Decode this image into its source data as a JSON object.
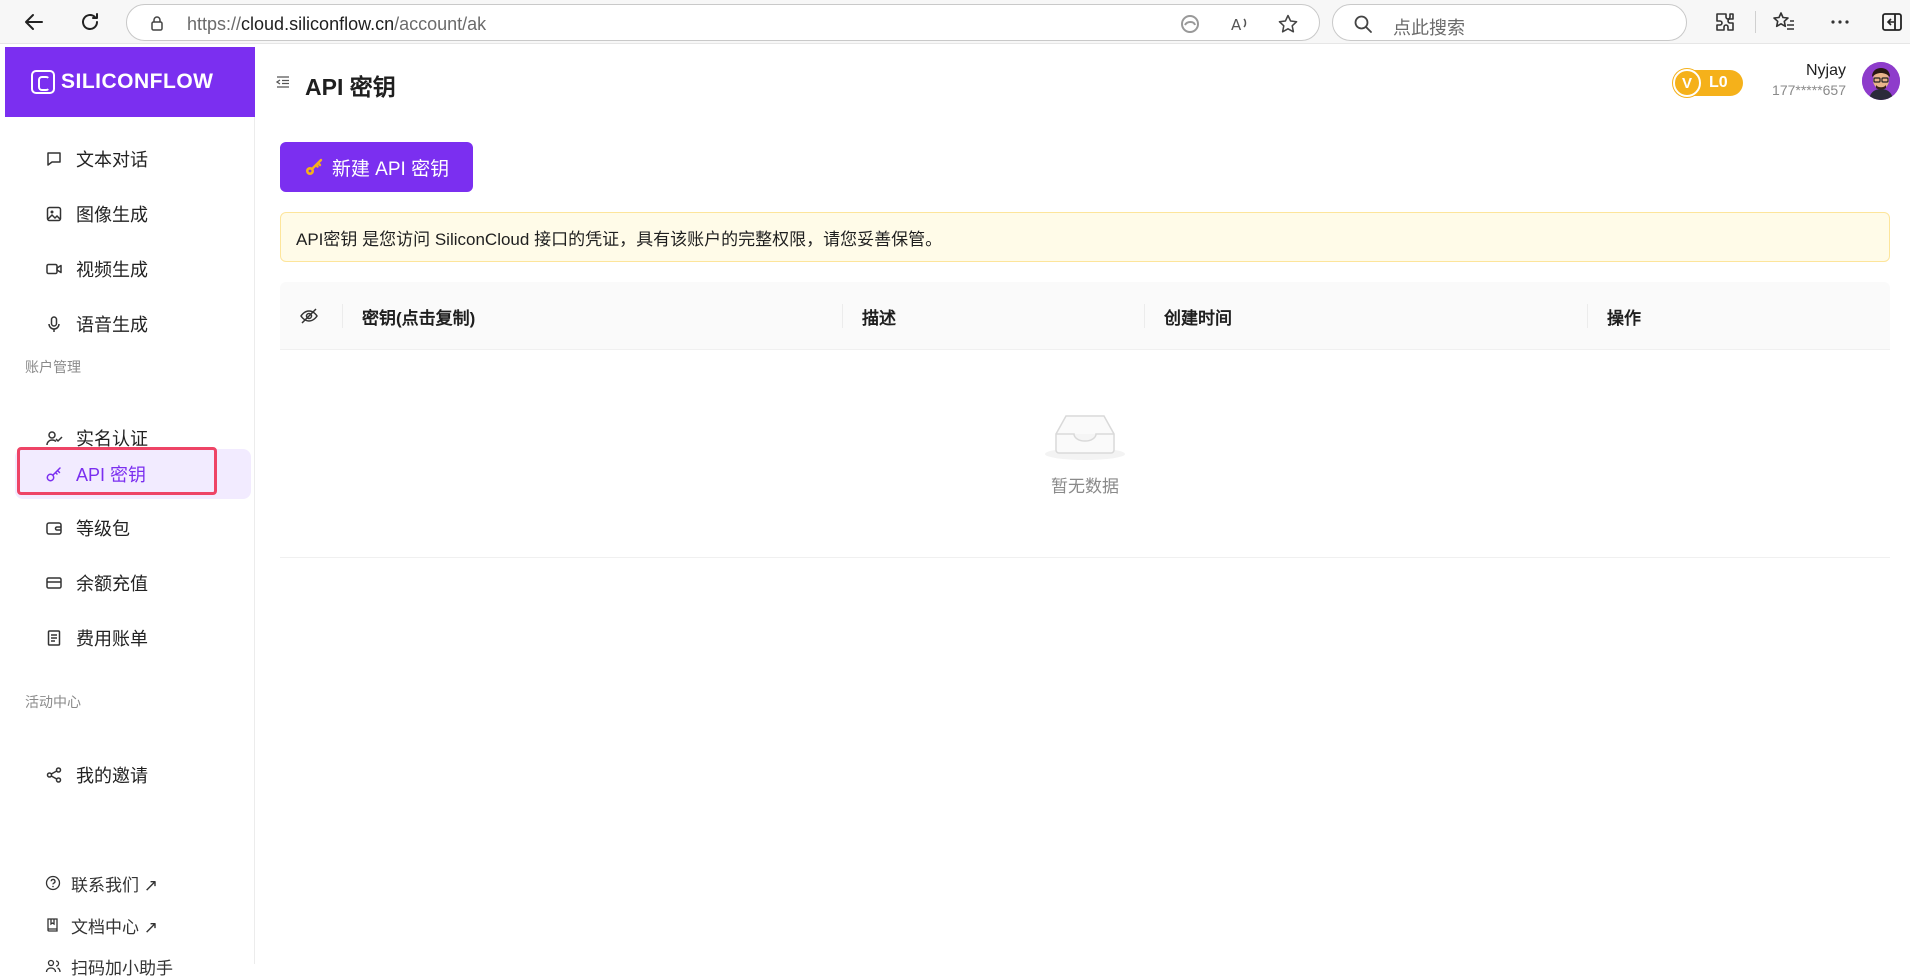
{
  "browser": {
    "url_prefix": "https://",
    "url_host": "cloud.siliconflow.cn",
    "url_path": "/account/ak",
    "search_placeholder": "点此搜索"
  },
  "sidebar": {
    "logo_text": "SILICONFLOW",
    "items": [
      {
        "label": "文本对话",
        "icon": "chat-icon"
      },
      {
        "label": "图像生成",
        "icon": "image-icon"
      },
      {
        "label": "视频生成",
        "icon": "video-icon"
      },
      {
        "label": "语音生成",
        "icon": "mic-icon"
      }
    ],
    "account_section": "账户管理",
    "account_items": [
      {
        "label": "实名认证",
        "icon": "user-check-icon"
      },
      {
        "label": "API 密钥",
        "icon": "key-icon",
        "active": true
      },
      {
        "label": "等级包",
        "icon": "wallet-icon"
      },
      {
        "label": "余额充值",
        "icon": "card-icon"
      },
      {
        "label": "费用账单",
        "icon": "bill-icon"
      }
    ],
    "activity_section": "活动中心",
    "activity_items": [
      {
        "label": "我的邀请",
        "icon": "share-icon"
      }
    ],
    "footer": [
      {
        "label": "联系我们 ↗",
        "icon": "help-icon"
      },
      {
        "label": "文档中心 ↗",
        "icon": "book-icon"
      },
      {
        "label": "扫码加小助手",
        "icon": "users-icon"
      }
    ]
  },
  "header": {
    "title": "API 密钥",
    "level_badge": "L0",
    "level_letter": "V",
    "user_name": "Nyjay",
    "user_phone": "177*****657"
  },
  "main": {
    "new_key_label": "新建 API 密钥",
    "notice": "API密钥 是您访问 SiliconCloud 接口的凭证，具有该账户的完整权限，请您妥善保管。",
    "columns": [
      "密钥(点击复制)",
      "描述",
      "创建时间",
      "操作"
    ],
    "empty_text": "暂无数据"
  },
  "colors": {
    "brand": "#7b2ff0",
    "active_bg": "#f2ebff",
    "highlight": "#ee4466",
    "badge": "#f5b11a"
  }
}
